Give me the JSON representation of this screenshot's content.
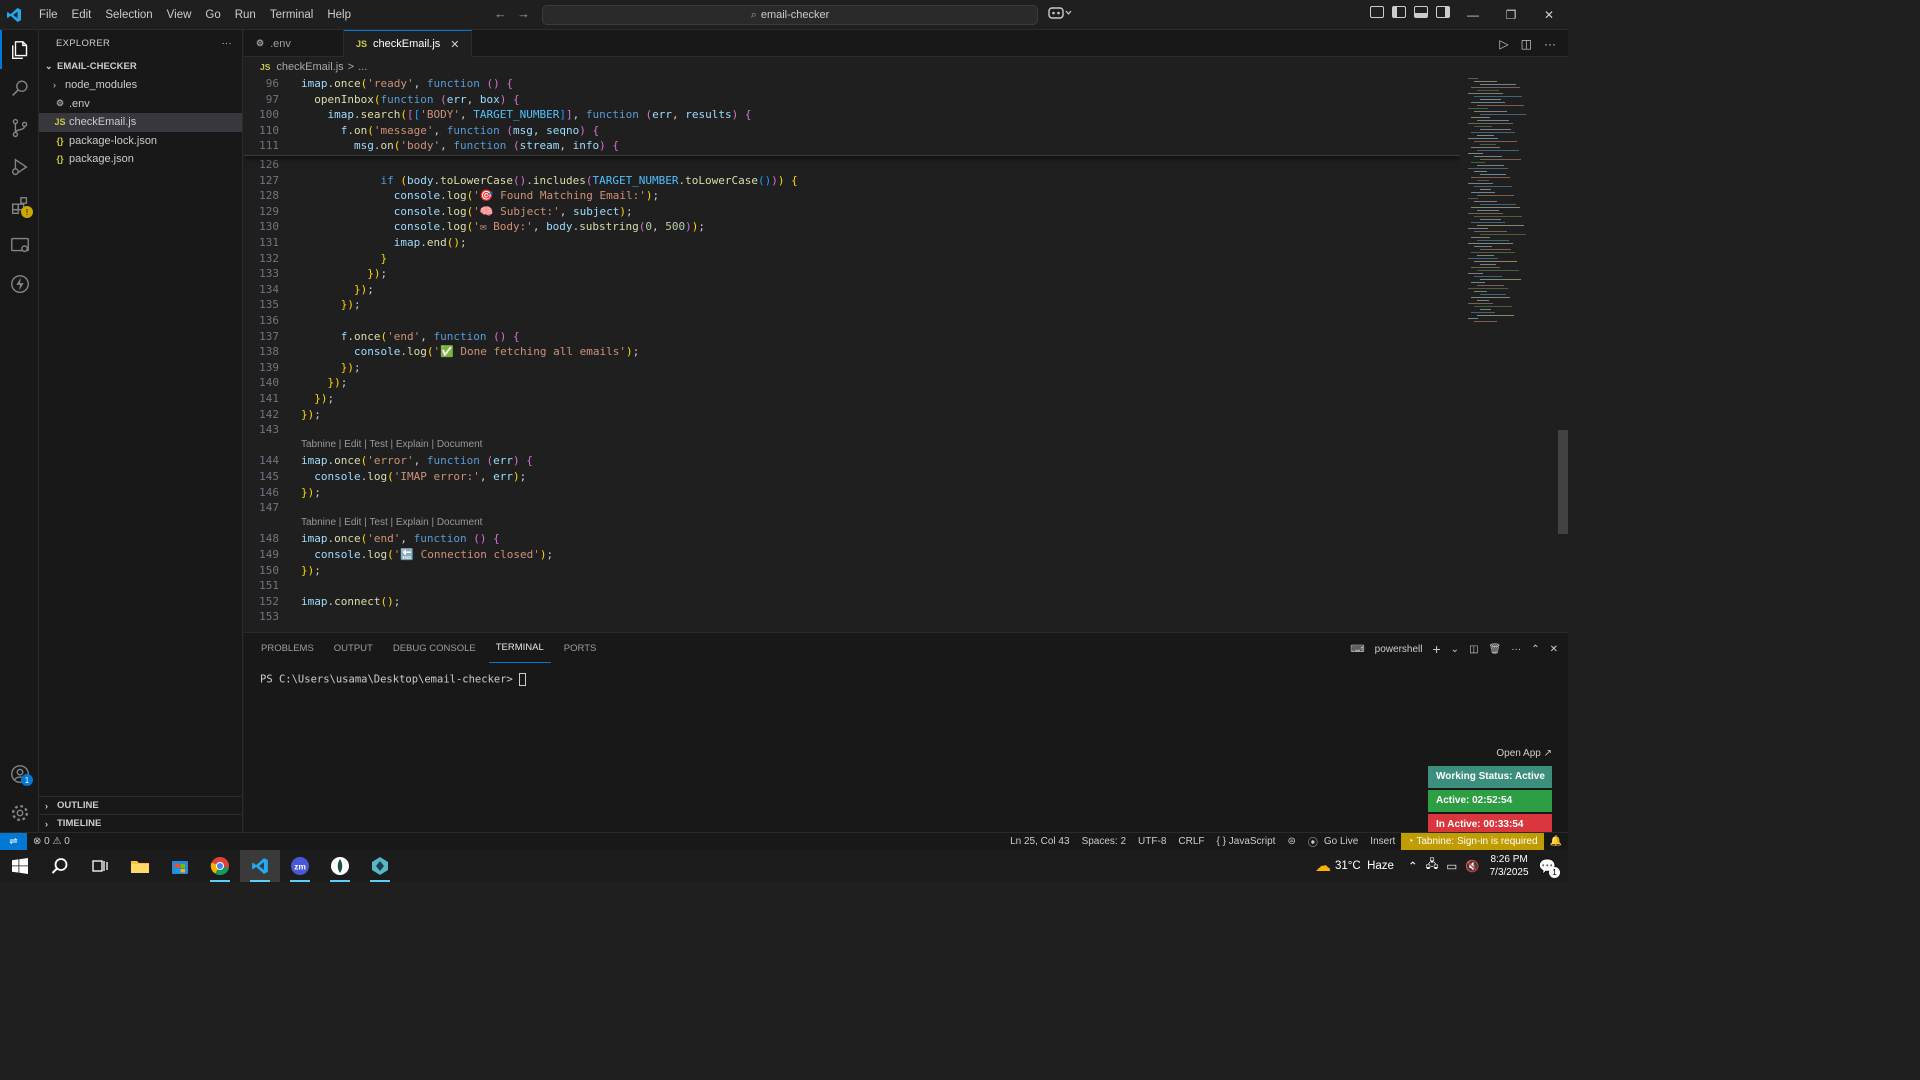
{
  "menu": [
    "File",
    "Edit",
    "Selection",
    "View",
    "Go",
    "Run",
    "Terminal",
    "Help"
  ],
  "search": {
    "text": "email-checker"
  },
  "explorer": {
    "title": "EXPLORER",
    "folder": "EMAIL-CHECKER",
    "items": [
      {
        "label": "node_modules",
        "icon": ">"
      },
      {
        "label": ".env",
        "icon": "⚙"
      },
      {
        "label": "checkEmail.js",
        "icon": "JS"
      },
      {
        "label": "package-lock.json",
        "icon": "{}"
      },
      {
        "label": "package.json",
        "icon": "{}"
      }
    ],
    "outline": "OUTLINE",
    "timeline": "TIMELINE"
  },
  "tabs": [
    {
      "label": ".env",
      "icon": "⚙"
    },
    {
      "label": "checkEmail.js",
      "icon": "JS"
    }
  ],
  "breadcrumb": {
    "file": "checkEmail.js",
    "sep": ">",
    "rest": "..."
  },
  "sticky_lines": [
    {
      "num": "96",
      "code": "imap.once('ready', function () {"
    },
    {
      "num": "97",
      "code": "  openInbox(function (err, box) {"
    },
    {
      "num": "100",
      "code": "    imap.search([['BODY', TARGET_NUMBER]], function (err, results) {"
    },
    {
      "num": "110",
      "code": "      f.on('message', function (msg, seqno) {"
    },
    {
      "num": "111",
      "code": "        msg.on('body', function (stream, info) {"
    }
  ],
  "code_lines": [
    {
      "num": "126",
      "code": ""
    },
    {
      "num": "127",
      "code": "            if (body.toLowerCase().includes(TARGET_NUMBER.toLowerCase())) {"
    },
    {
      "num": "128",
      "code": "              console.log('🎯 Found Matching Email:');"
    },
    {
      "num": "129",
      "code": "              console.log('🧠 Subject:', subject);"
    },
    {
      "num": "130",
      "code": "              console.log('✉ Body:', body.substring(0, 500));"
    },
    {
      "num": "131",
      "code": "              imap.end();"
    },
    {
      "num": "132",
      "code": "            }"
    },
    {
      "num": "133",
      "code": "          });"
    },
    {
      "num": "134",
      "code": "        });"
    },
    {
      "num": "135",
      "code": "      });"
    },
    {
      "num": "136",
      "code": ""
    },
    {
      "num": "137",
      "code": "      f.once('end', function () {"
    },
    {
      "num": "138",
      "code": "        console.log('✅ Done fetching all emails');"
    },
    {
      "num": "139",
      "code": "      });"
    },
    {
      "num": "140",
      "code": "    });"
    },
    {
      "num": "141",
      "code": "  });"
    },
    {
      "num": "142",
      "code": "});"
    },
    {
      "num": "143",
      "code": ""
    },
    {
      "lens": "Tabnine | Edit | Test | Explain | Document"
    },
    {
      "num": "144",
      "code": "imap.once('error', function (err) {"
    },
    {
      "num": "145",
      "code": "  console.log('IMAP error:', err);"
    },
    {
      "num": "146",
      "code": "});"
    },
    {
      "num": "147",
      "code": ""
    },
    {
      "lens": "Tabnine | Edit | Test | Explain | Document"
    },
    {
      "num": "148",
      "code": "imap.once('end', function () {"
    },
    {
      "num": "149",
      "code": "  console.log('🔚 Connection closed');"
    },
    {
      "num": "150",
      "code": "});"
    },
    {
      "num": "151",
      "code": ""
    },
    {
      "num": "152",
      "code": "imap.connect();"
    },
    {
      "num": "153",
      "code": ""
    }
  ],
  "panel": {
    "tabs": [
      "PROBLEMS",
      "OUTPUT",
      "DEBUG CONSOLE",
      "TERMINAL",
      "PORTS"
    ],
    "shell": "powershell",
    "prompt": "PS C:\\Users\\usama\\Desktop\\email-checker> "
  },
  "tracker": {
    "open": "Open App ↗",
    "status": "Working Status: Active",
    "active": "Active: 02:52:54",
    "inactive": "In Active: 00:33:54",
    "colors": {
      "status": "#3c8f7c",
      "active": "#2e9e45",
      "inactive": "#d9363e"
    }
  },
  "statusbar": {
    "errors": "⊗ 0 ⚠ 0",
    "position": "Ln 25, Col 43",
    "spaces": "Spaces: 2",
    "encoding": "UTF-8",
    "eol": "CRLF",
    "language": "{ } JavaScript",
    "golive": "Go Live",
    "mode": "Insert",
    "tabnine": "Tabnine: Sign-in is required"
  },
  "taskbar": {
    "weather": "31°C  Haze",
    "time": "8:26 PM",
    "date": "7/3/2025",
    "notif": "1"
  },
  "colors": {
    "accent": "#0078d4",
    "tabnine": "#c19c00"
  }
}
